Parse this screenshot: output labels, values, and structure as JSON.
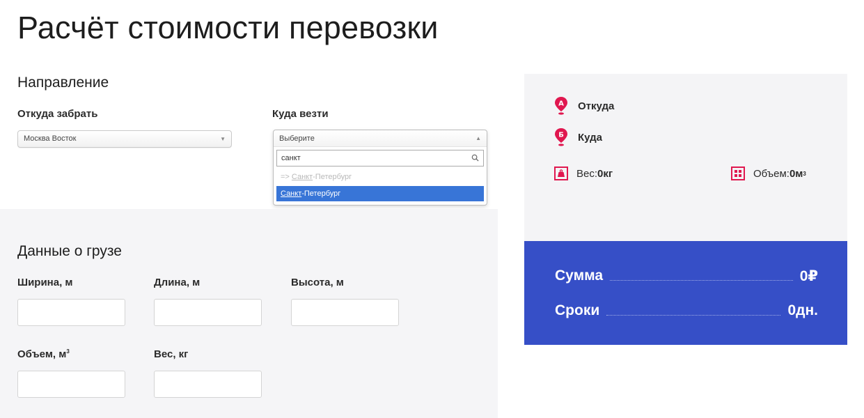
{
  "page": {
    "title": "Расчёт стоимости перевозки"
  },
  "direction": {
    "section_title": "Направление",
    "from": {
      "label": "Откуда забрать",
      "value": "Москва Восток"
    },
    "to": {
      "label": "Куда везти",
      "placeholder": "Выберите",
      "search_value": "санкт",
      "options": [
        {
          "prefix": "=> ",
          "match": "Санкт",
          "rest": "-Петербург",
          "disabled": true
        },
        {
          "prefix": "",
          "match": "Санкт",
          "rest": "-Петербург",
          "highlighted": true
        }
      ]
    }
  },
  "cargo": {
    "section_title": "Данные о грузе",
    "width_label": "Ширина, м",
    "length_label": "Длина, м",
    "height_label": "Высота, м",
    "volume_label": "Объем, м",
    "volume_sup": "3",
    "weight_label": "Вес, кг"
  },
  "summary": {
    "from_label": "Откуда",
    "to_label": "Куда",
    "from_pin_letter": "А",
    "to_pin_letter": "Б",
    "weight_prefix": "Вес:",
    "weight_value": "0кг",
    "volume_prefix": "Объем:",
    "volume_value": "0м",
    "volume_sup": "3"
  },
  "total": {
    "sum_label": "Сумма",
    "sum_value": "0₽",
    "term_label": "Сроки",
    "term_value": "0дн."
  },
  "colors": {
    "accent_blue": "#364fc7",
    "pin_red": "#e0174f",
    "select_highlight": "#3875d7"
  }
}
